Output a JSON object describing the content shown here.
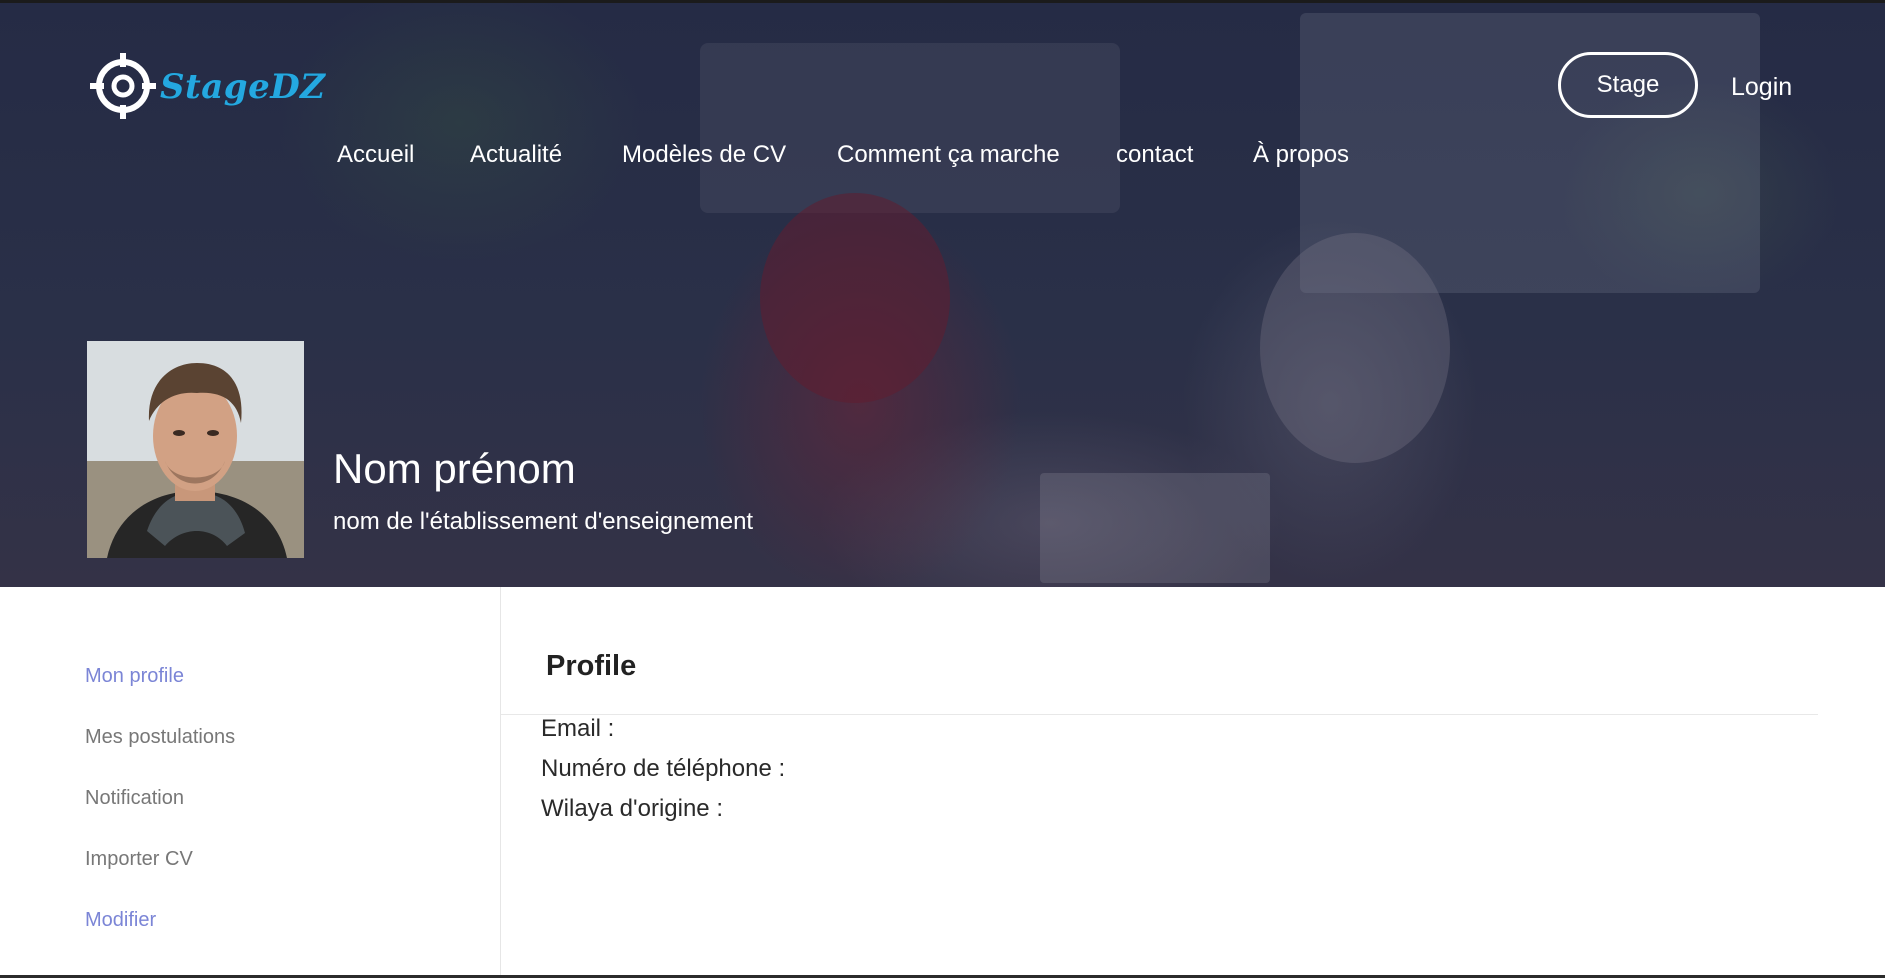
{
  "header": {
    "logo_text": "StageDZ",
    "logo_icon": "crosshair-target-icon",
    "stage_button": "Stage",
    "login_link": "Login"
  },
  "nav": {
    "items": [
      "Accueil",
      "Actualité",
      "Modèles de CV",
      "Comment ça marche",
      "contact",
      "À propos"
    ]
  },
  "profile_banner": {
    "name": "Nom prénom",
    "institution": "nom de l'établissement d'enseignement"
  },
  "sidebar": {
    "items": [
      {
        "label": "Mon profile",
        "active": true
      },
      {
        "label": "Mes postulations",
        "active": false
      },
      {
        "label": "Notification",
        "active": false
      },
      {
        "label": "Importer CV",
        "active": false
      },
      {
        "label": "Modifier",
        "active": true
      }
    ]
  },
  "profile_card": {
    "title": "Profile",
    "fields": [
      {
        "label": "Email :"
      },
      {
        "label": "Numéro de téléphone :"
      },
      {
        "label": "Wilaya d'origine :"
      }
    ]
  },
  "colors": {
    "accent": "#7b85d6",
    "logo_blue": "#24a8e0",
    "hero_overlay": "#262c46"
  }
}
